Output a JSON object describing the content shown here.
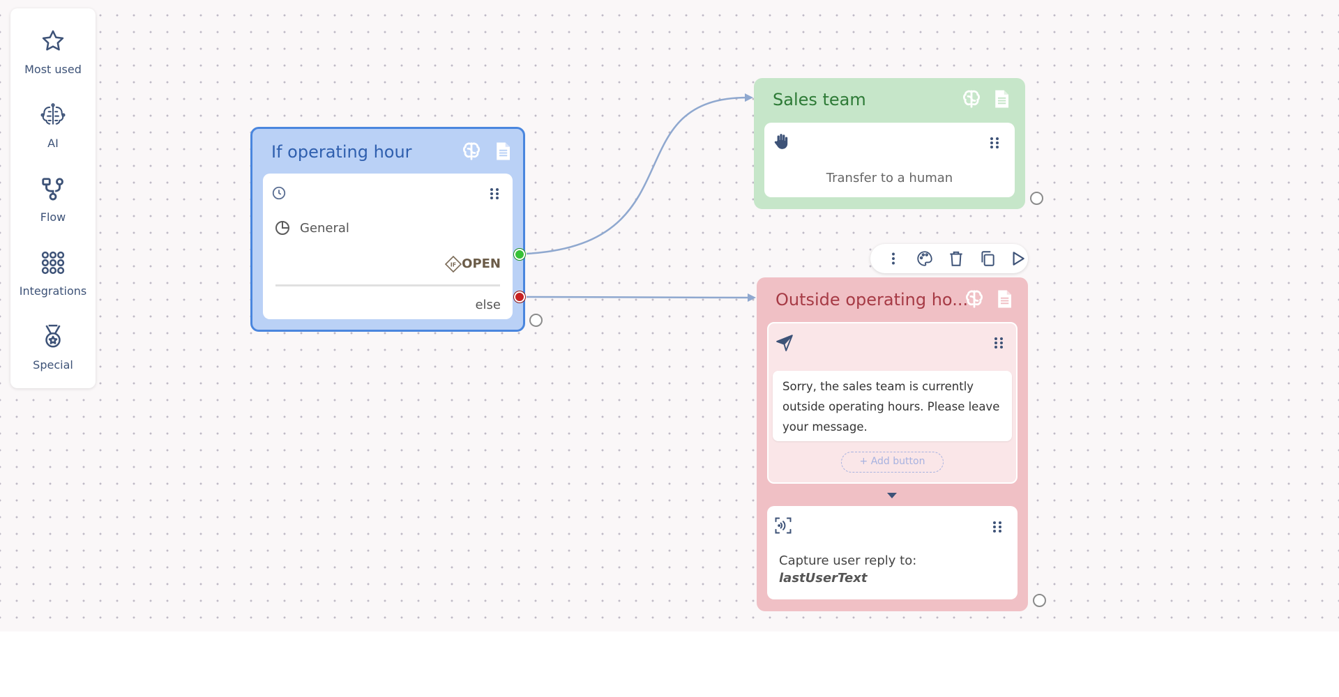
{
  "palette": {
    "items": [
      {
        "label": "Most used",
        "icon": "star-icon"
      },
      {
        "label": "AI",
        "icon": "brain-circuit-icon"
      },
      {
        "label": "Flow",
        "icon": "flow-branch-icon"
      },
      {
        "label": "Integrations",
        "icon": "grid-dots-icon"
      },
      {
        "label": "Special",
        "icon": "medal-icon"
      }
    ]
  },
  "nodes": {
    "operating_hour": {
      "title": "If operating hour",
      "schedule": "General",
      "open_label": "OPEN",
      "else_label": "else"
    },
    "sales_team": {
      "title": "Sales team",
      "action": "Transfer to a human"
    },
    "outside_hours": {
      "title": "Outside operating ho...",
      "message": "Sorry, the sales team is currently outside operating hours. Please leave your message.",
      "add_button": "+ Add button",
      "capture_label": "Capture user reply to:",
      "capture_variable": "lastUserText"
    }
  },
  "colors": {
    "blue_node_bg": "#bad1f6",
    "blue_node_border": "#4a86de",
    "green_node_bg": "#c6e6c9",
    "red_node_bg": "#f0c0c5",
    "edge": "#8fa8cf",
    "port_open": "#36c236",
    "port_else": "#c82121"
  }
}
